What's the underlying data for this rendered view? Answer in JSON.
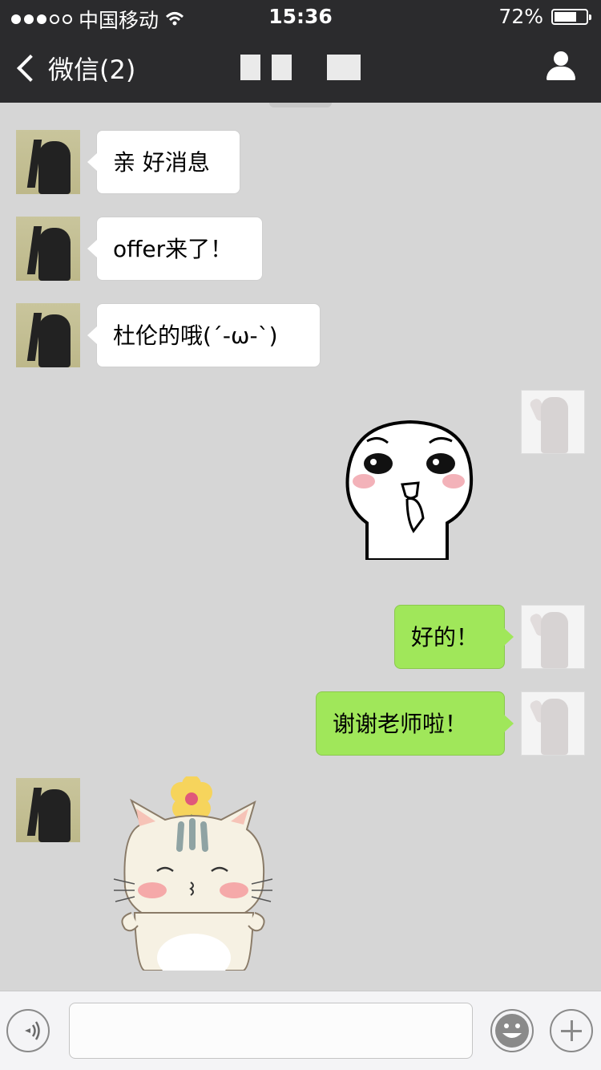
{
  "status_bar": {
    "carrier": "中国移动",
    "time": "15:36",
    "battery": "72%",
    "battery_level": 0.72
  },
  "nav": {
    "back_label": "微信(2)"
  },
  "messages": [
    {
      "side": "in",
      "type": "text",
      "text": "亲 好消息"
    },
    {
      "side": "in",
      "type": "text",
      "text": "offer来了！"
    },
    {
      "side": "in",
      "type": "text",
      "text": "杜伦的哦(´-ω-`)"
    },
    {
      "side": "out",
      "type": "sticker",
      "sticker": "worried-face-sticker"
    },
    {
      "side": "out",
      "type": "text",
      "text": "好的！"
    },
    {
      "side": "out",
      "type": "text",
      "text": "谢谢老师啦！"
    },
    {
      "side": "in",
      "type": "sticker",
      "sticker": "cat-with-flower-sticker"
    }
  ],
  "input_bar": {
    "voice_icon": "voice-icon",
    "emoji_icon": "emoji-icon",
    "plus_icon": "plus-icon"
  },
  "colors": {
    "nav_bg": "#2b2b2d",
    "chat_bg": "#d6d6d6",
    "outgoing_bubble": "#a0e75a",
    "incoming_bubble": "#ffffff"
  }
}
